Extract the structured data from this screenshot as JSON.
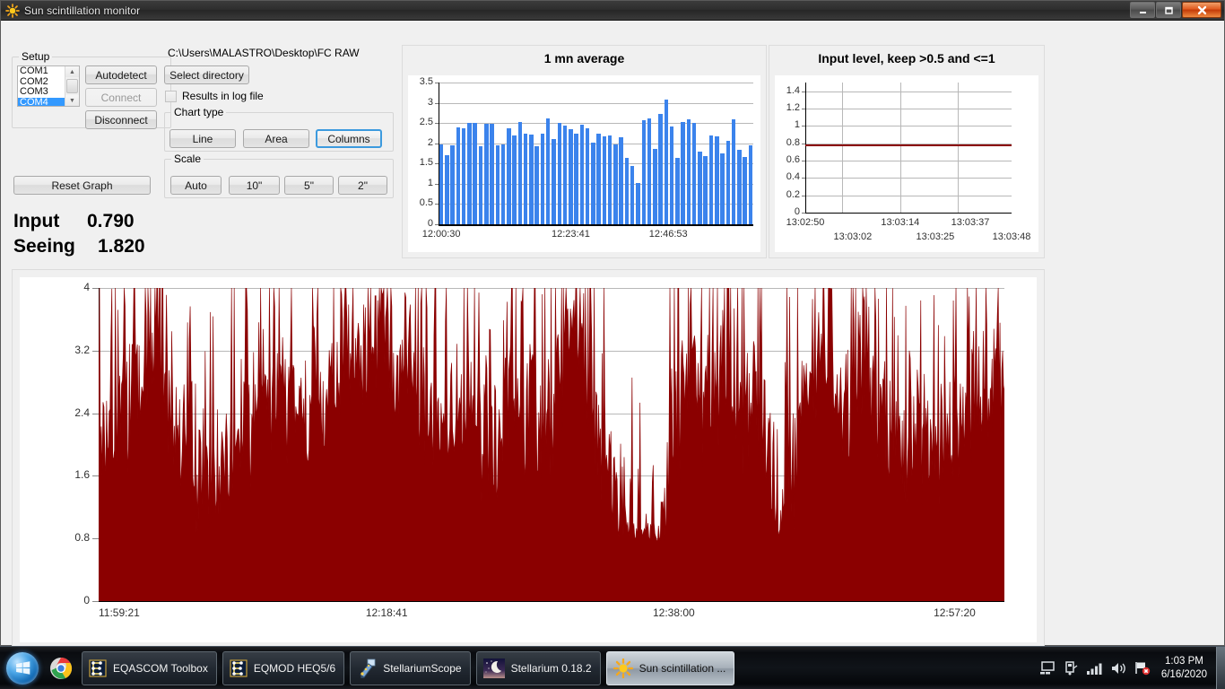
{
  "window": {
    "title": "Sun scintillation monitor",
    "icon": "sun-icon",
    "minimize_label": "—",
    "maximize_label": "❐",
    "close_label": "✕"
  },
  "setup": {
    "group_label": "Setup",
    "ports": [
      "COM1",
      "COM2",
      "COM3",
      "COM4"
    ],
    "selected_port": "COM4",
    "autodetect_label": "Autodetect",
    "connect_label": "Connect",
    "connect_enabled": false,
    "disconnect_label": "Disconnect"
  },
  "directory": {
    "path": "C:\\Users\\MALASTRO\\Desktop\\FC RAW",
    "select_label": "Select directory",
    "log_checkbox_label": "Results in log file",
    "log_checkbox_checked": false
  },
  "chart_type": {
    "group_label": "Chart type",
    "options": [
      "Line",
      "Area",
      "Columns"
    ],
    "selected": "Columns"
  },
  "scale": {
    "group_label": "Scale",
    "options": [
      "Auto",
      "10\"",
      "5\"",
      "2\""
    ],
    "selected": null
  },
  "reset_graph_label": "Reset Graph",
  "readouts": {
    "input_label": "Input",
    "input_value": "0.790",
    "seeing_label": "Seeing",
    "seeing_value": "1.820"
  },
  "colors": {
    "bar_blue": "#3b83ec",
    "area_red": "#8b0000",
    "grid": "#b8b8b8",
    "plot_bg": "#ffffff",
    "panel_bg": "#f0f0f0",
    "accent_selected": "#3c9ade"
  },
  "chart_data": [
    {
      "id": "one-minute-average",
      "type": "bar",
      "title": "1 mn average",
      "xlabel": "",
      "ylabel": "",
      "ylim": [
        0,
        3.5
      ],
      "yticks": [
        0,
        0.5,
        1,
        1.5,
        2,
        2.5,
        3,
        3.5
      ],
      "ytick_labels": [
        "0",
        "0.5",
        "1",
        "1.5",
        "2",
        "2.5",
        "3",
        "3.5"
      ],
      "xtick_labels": [
        "12:00:30",
        "12:23:41",
        "12:46:53"
      ],
      "grid": true,
      "legend": null,
      "series_color": "#3b83ec",
      "values": [
        1.97,
        1.7,
        1.96,
        2.4,
        2.37,
        2.51,
        2.5,
        1.92,
        2.49,
        2.49,
        1.95,
        1.97,
        2.38,
        2.19,
        2.53,
        2.23,
        2.21,
        1.92,
        2.23,
        2.61,
        2.1,
        2.51,
        2.43,
        2.35,
        2.23,
        2.45,
        2.37,
        2.01,
        2.24,
        2.18,
        2.19,
        1.97,
        2.14,
        1.63,
        1.44,
        1.03,
        2.57,
        2.61,
        1.86,
        2.73,
        3.09,
        2.42,
        1.65,
        2.53,
        2.59,
        2.5,
        1.8,
        1.68,
        2.2,
        2.18,
        1.74,
        2.07,
        2.6,
        1.85,
        1.66,
        1.94
      ]
    },
    {
      "id": "input-level",
      "type": "line",
      "title": "Input level, keep >0.5 and <=1",
      "xlabel": "",
      "ylabel": "",
      "ylim": [
        0,
        1.5
      ],
      "yticks": [
        0,
        0.2,
        0.4,
        0.6,
        0.8,
        1,
        1.2,
        1.4
      ],
      "ytick_labels": [
        "0",
        "0.2",
        "0.4",
        "0.6",
        "0.8",
        "1",
        "1.2",
        "1.4"
      ],
      "xtick_labels_top": [
        "13:02:50",
        "13:03:14",
        "13:03:37"
      ],
      "xtick_labels_bottom": [
        "13:03:02",
        "13:03:25",
        "13:03:48"
      ],
      "grid": true,
      "series_color": "#8b0000",
      "constant_value": 0.79
    },
    {
      "id": "raw-scintillation",
      "type": "area",
      "title": "",
      "xlabel": "",
      "ylabel": "",
      "ylim": [
        0,
        4
      ],
      "yticks": [
        0,
        0.8,
        1.6,
        2.4,
        3.2,
        4
      ],
      "ytick_labels": [
        "0",
        "0.8",
        "1.6",
        "2.4",
        "3.2",
        "4"
      ],
      "xtick_labels": [
        "11:59:21",
        "12:18:41",
        "12:38:00",
        "12:57:20"
      ],
      "grid": true,
      "series_color": "#8b0000",
      "seed": 20200616,
      "n_points": 1030,
      "baseline": 2.45,
      "description": "Dense raw scintillation trace, spiky, mostly between 1.0 and 4.0 with clipping at 4"
    }
  ],
  "taskbar": {
    "start_label": "Start",
    "quick_launch": [
      {
        "name": "chrome-icon"
      }
    ],
    "buttons": [
      {
        "label": "EQASCOM Toolbox",
        "icon": "eqascom-icon",
        "active": false
      },
      {
        "label": "EQMOD HEQ5/6",
        "icon": "eqmod-icon",
        "active": false
      },
      {
        "label": "StellariumScope",
        "icon": "stellariumscope-icon",
        "active": false
      },
      {
        "label": "Stellarium 0.18.2",
        "icon": "stellarium-icon",
        "active": false
      },
      {
        "label": "Sun scintillation ...",
        "icon": "sun-icon",
        "active": true
      }
    ],
    "tray_icons": [
      "monitor-icon",
      "usb-eject-icon",
      "network-signal-icon",
      "volume-icon",
      "action-center-flag-icon"
    ],
    "clock_time": "1:03 PM",
    "clock_date": "6/16/2020"
  }
}
